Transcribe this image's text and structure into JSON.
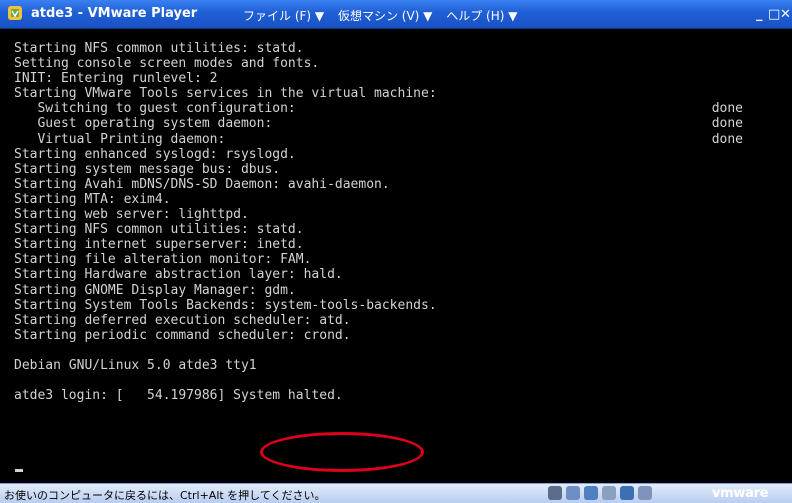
{
  "window": {
    "title": "atde3 - VMware Player",
    "menus": [
      "ファイル (F) ▼",
      "仮想マシン (V) ▼",
      "ヘルプ (H) ▼"
    ],
    "minimize": "_",
    "maximize": "□",
    "close": "✕"
  },
  "console": {
    "lines": [
      {
        "text": "Starting NFS common utilities: statd."
      },
      {
        "text": "Setting console screen modes and fonts."
      },
      {
        "text": "INIT: Entering runlevel: 2"
      },
      {
        "text": "Starting VMware Tools services in the virtual machine:"
      },
      {
        "text": "   Switching to guest configuration:",
        "status": "done"
      },
      {
        "text": "   Guest operating system daemon:",
        "status": "done"
      },
      {
        "text": "   Virtual Printing daemon:",
        "status": "done"
      },
      {
        "text": "Starting enhanced syslogd: rsyslogd."
      },
      {
        "text": "Starting system message bus: dbus."
      },
      {
        "text": "Starting Avahi mDNS/DNS-SD Daemon: avahi-daemon."
      },
      {
        "text": "Starting MTA: exim4."
      },
      {
        "text": "Starting web server: lighttpd."
      },
      {
        "text": "Starting NFS common utilities: statd."
      },
      {
        "text": "Starting internet superserver: inetd."
      },
      {
        "text": "Starting file alteration monitor: FAM."
      },
      {
        "text": "Starting Hardware abstraction layer: hald."
      },
      {
        "text": "Starting GNOME Display Manager: gdm."
      },
      {
        "text": "Starting System Tools Backends: system-tools-backends."
      },
      {
        "text": "Starting deferred execution scheduler: atd."
      },
      {
        "text": "Starting periodic command scheduler: crond."
      },
      {
        "text": ""
      },
      {
        "text": "Debian GNU/Linux 5.0 atde3 tty1"
      },
      {
        "text": ""
      },
      {
        "text": "atde3 login: [   54.197986] System halted."
      }
    ]
  },
  "statusbar": {
    "hint": "お使いのコンピュータに戻るには、Ctrl+Alt を押してください。",
    "brand": "vmware",
    "devices": [
      {
        "icon": "hard-disk-icon",
        "color": "#5a6e8c"
      },
      {
        "icon": "cd-drive-icon",
        "color": "#6d8fc4"
      },
      {
        "icon": "network-adapter-icon",
        "color": "#4f7fc0"
      },
      {
        "icon": "usb-device-icon",
        "color": "#8aa0c0"
      },
      {
        "icon": "sound-card-icon",
        "color": "#3d6fb3"
      },
      {
        "icon": "printer-icon",
        "color": "#7d93b8"
      }
    ]
  },
  "colors": {
    "titlebar": "#1f5fd6",
    "console_text": "#d3d3d3",
    "highlight": "#e0001a",
    "statusbar": "#c7d8f4"
  }
}
